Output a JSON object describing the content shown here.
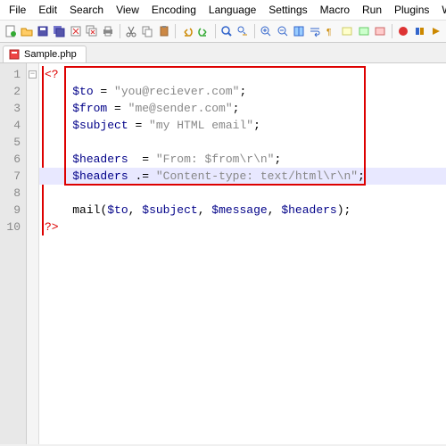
{
  "menu": {
    "items": [
      "File",
      "Edit",
      "Search",
      "View",
      "Encoding",
      "Language",
      "Settings",
      "Macro",
      "Run",
      "Plugins",
      "Window"
    ]
  },
  "toolbar": {
    "icons": [
      "new-file",
      "open-file",
      "save",
      "save-all",
      "close",
      "close-all",
      "print",
      "cut",
      "copy",
      "paste",
      "undo",
      "redo",
      "find",
      "replace",
      "zoom-in",
      "zoom-out",
      "sync",
      "word-wrap",
      "show-all",
      "indent",
      "outdent",
      "folder",
      "macro-rec",
      "macro-play",
      "macro-stop"
    ]
  },
  "tab": {
    "filename": "Sample.php"
  },
  "gutter": {
    "lines": [
      "1",
      "2",
      "3",
      "4",
      "5",
      "6",
      "7",
      "8",
      "9",
      "10"
    ]
  },
  "code": {
    "l1_open": "<?",
    "l2_var": "$to",
    "l2_op": " = ",
    "l2_str": "\"you@reciever.com\"",
    "l2_end": ";",
    "l3_var": "$from",
    "l3_op": " = ",
    "l3_str": "\"me@sender.com\"",
    "l3_end": ";",
    "l4_var": "$subject",
    "l4_op": " = ",
    "l4_str": "\"my HTML email\"",
    "l4_end": ";",
    "l6_var": "$headers",
    "l6_op": "  = ",
    "l6_str": "\"From: $from\\r\\n\"",
    "l6_end": ";",
    "l7_var": "$headers",
    "l7_op": " .= ",
    "l7_str": "\"Content-type: text/html\\r\\n\"",
    "l7_end": ";",
    "l9_func": "mail",
    "l9_open": "(",
    "l9_a1": "$to",
    "l9_c1": ", ",
    "l9_a2": "$subject",
    "l9_c2": ", ",
    "l9_a3": "$message",
    "l9_c3": ", ",
    "l9_a4": "$headers",
    "l9_close": ");",
    "l10_close": "?>"
  }
}
